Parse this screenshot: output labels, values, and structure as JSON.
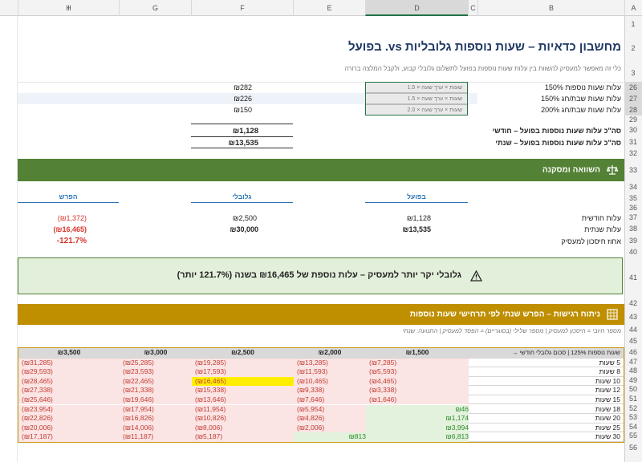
{
  "columns": [
    "I",
    "H",
    "G",
    "F",
    "E",
    "D",
    "C",
    "B",
    "A"
  ],
  "rows": [
    "1",
    "2",
    "3",
    "26",
    "27",
    "28",
    "29",
    "30",
    "31",
    "32",
    "33",
    "34",
    "35",
    "36",
    "37",
    "38",
    "39",
    "40",
    "41",
    "42",
    "43",
    "44",
    "45",
    "46",
    "47",
    "48",
    "49",
    "50",
    "51",
    "52",
    "53",
    "54",
    "55",
    "56"
  ],
  "header": {
    "title": "מחשבון כדאיות – שעות נוספות גלובליות vs. בפועל",
    "subtitle": "כלי זה מאפשר למעסיק להשוות בין עלות שעות נוספות בפועל לתשלום גלובלי קבוע, ולקבל המלצה ברורה"
  },
  "costs": [
    {
      "label": "עלות שעות נוספות 150%",
      "formula": "שעות × ערך שעה × 1.5",
      "value": "₪282"
    },
    {
      "label": "עלות שעות שבת/חג 150%",
      "formula": "שעות × ערך שעה × 1.5",
      "value": "₪226"
    },
    {
      "label": "עלות שעות שבת/חג 200%",
      "formula": "שעות × ערך שעה × 2.0",
      "value": "₪150"
    }
  ],
  "totals": [
    {
      "label": "סה\"כ עלות שעות נוספות בפועל – חודשי",
      "value": "₪1,128"
    },
    {
      "label": "סה\"כ עלות שעות נוספות בפועל – שנתי",
      "value": "₪13,535"
    }
  ],
  "comparison": {
    "banner": "השוואה ומסקנה",
    "col_actual": "בפועל",
    "col_global": "גלובלי",
    "col_diff": "הפרש",
    "rows": [
      {
        "label": "עלות חודשית",
        "actual": "₪1,128",
        "global": "₪2,500",
        "diff": "(₪1,372)"
      },
      {
        "label": "עלות שנתית",
        "actual": "₪13,535",
        "global": "₪30,000",
        "diff": "(₪16,465)"
      },
      {
        "label": "אחוז חיסכון למעסיק",
        "actual": "",
        "global": "",
        "diff": "-121.7%"
      }
    ],
    "conclusion": "גלובלי יקר יותר למעסיק – עלות נוספת של ₪16,465 בשנה (121.7% יותר)"
  },
  "sensitivity": {
    "banner": "ניתוח רגישות – הפרש שנתי לפי תרחישי שעות נוספות",
    "legend": "מספר חיובי = חיסכון למעסיק | מספר שלילי (בסוגריים) = הפסד למעסיק | התנועה: שנתי",
    "corner": "שעות נוספות 125% | סכום גלובלי חודשי →",
    "col_heads": [
      "₪1,500",
      "₪2,000",
      "₪2,500",
      "₪3,000",
      "₪3,500"
    ],
    "rows": [
      {
        "label": "5 שעות",
        "vals": [
          "(₪7,285)",
          "(₪13,285)",
          "(₪19,285)",
          "(₪25,285)",
          "(₪31,285)"
        ]
      },
      {
        "label": "8 שעות",
        "vals": [
          "(₪5,593)",
          "(₪11,593)",
          "(₪17,593)",
          "(₪23,593)",
          "(₪29,593)"
        ]
      },
      {
        "label": "10 שעות",
        "vals": [
          "(₪4,465)",
          "(₪10,465)",
          "(₪16,465)",
          "(₪22,465)",
          "(₪28,465)"
        ]
      },
      {
        "label": "12 שעות",
        "vals": [
          "(₪3,338)",
          "(₪9,338)",
          "(₪15,338)",
          "(₪21,338)",
          "(₪27,338)"
        ]
      },
      {
        "label": "15 שעות",
        "vals": [
          "(₪1,646)",
          "(₪7,646)",
          "(₪13,646)",
          "(₪19,646)",
          "(₪25,646)"
        ]
      },
      {
        "label": "18 שעות",
        "vals": [
          "₪46",
          "(₪5,954)",
          "(₪11,954)",
          "(₪17,954)",
          "(₪23,954)"
        ]
      },
      {
        "label": "20 שעות",
        "vals": [
          "₪1,174",
          "(₪4,826)",
          "(₪10,826)",
          "(₪16,826)",
          "(₪22,826)"
        ]
      },
      {
        "label": "25 שעות",
        "vals": [
          "₪3,994",
          "(₪2,006)",
          "(₪8,006)",
          "(₪14,006)",
          "(₪20,006)"
        ]
      },
      {
        "label": "30 שעות",
        "vals": [
          "₪6,813",
          "₪813",
          "(₪5,187)",
          "(₪11,187)",
          "(₪17,187)"
        ]
      }
    ]
  },
  "colors": {
    "green_banner": "#538135",
    "gold_banner": "#bf8f00",
    "conclusion_bg": "#e2efda",
    "conclusion_border": "#538135"
  }
}
